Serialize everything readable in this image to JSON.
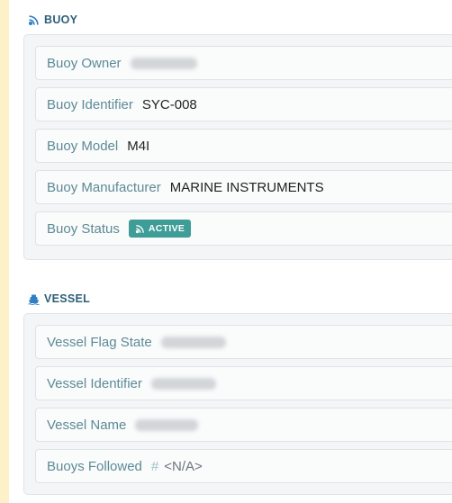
{
  "buoy": {
    "title": "BUOY",
    "icon": "signal-icon",
    "owner_label": "Buoy Owner",
    "owner_value": "Redacted",
    "identifier_label": "Buoy Identifier",
    "identifier_value": "SYC-008",
    "model_label": "Buoy Model",
    "model_value": "M4I",
    "manufacturer_label": "Buoy Manufacturer",
    "manufacturer_value": "MARINE INSTRUMENTS",
    "status_label": "Buoy Status",
    "status_value": "ACTIVE",
    "status_color": "#3e9d96"
  },
  "vessel": {
    "title": "VESSEL",
    "icon": "ship-icon",
    "flag_label": "Vessel Flag State",
    "flag_value": "Redacted",
    "identifier_label": "Vessel Identifier",
    "identifier_value": "Redacted",
    "name_label": "Vessel Name",
    "name_value": "Redacted",
    "buoys_followed_label": "Buoys Followed",
    "buoys_followed_value": "<N/A>"
  },
  "colors": {
    "label": "#5d8a96",
    "header": "#2c5f78",
    "page_background": "#fdf1c9"
  }
}
